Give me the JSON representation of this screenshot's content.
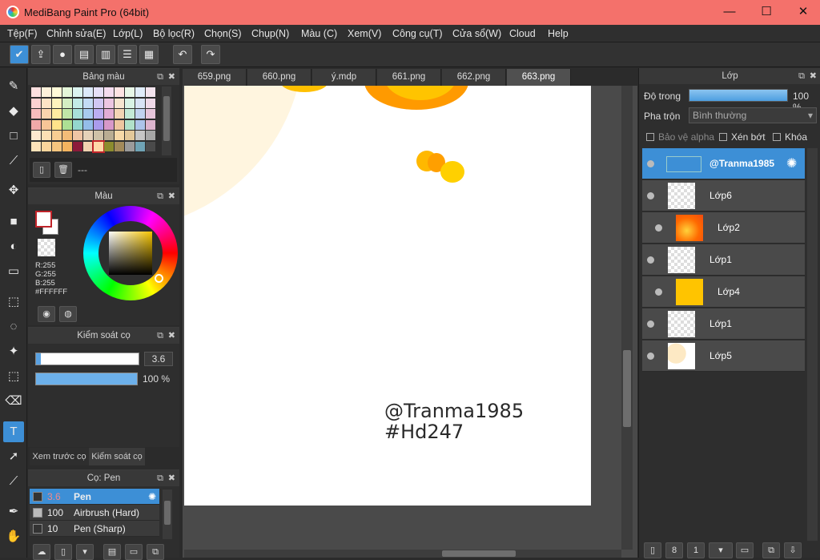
{
  "window": {
    "title": "MediBang Paint Pro (64bit)",
    "minimize": "—",
    "maximize": "☐",
    "close": "✕"
  },
  "menu": [
    "Tệp(F)",
    "Chỉnh sửa(E)",
    "Lớp(L)",
    "Bộ lọc(R)",
    "Chọn(S)",
    "Chụp(N)",
    "Màu (C)",
    "Xem(V)",
    "Công cụ(T)",
    "Cửa sổ(W)",
    "Cloud",
    "Help"
  ],
  "toolbar": {
    "undo": "↶",
    "redo": "↷"
  },
  "palette_panel": {
    "title": "Bảng màu",
    "set_label": "---"
  },
  "color_panel": {
    "title": "Màu",
    "r": "R:255",
    "g": "G:255",
    "b": "B:255",
    "hex": "#FFFFFF"
  },
  "brush_control": {
    "title": "Kiểm soát cọ",
    "size": "3.6",
    "opacity": "100 %",
    "opacity_value": 1.0
  },
  "bottom_tabs": [
    "Xem trước cọ",
    "Kiểm soát cọ"
  ],
  "brush_panel": {
    "title": "Cọ: Pen",
    "brushes": [
      {
        "size": "3.6",
        "name": "Pen",
        "color": "#333333"
      },
      {
        "size": "100",
        "name": "Airbrush (Hard)",
        "color": "#bbbbbb"
      },
      {
        "size": "10",
        "name": "Pen (Sharp)",
        "color": "#333333"
      }
    ]
  },
  "tabs": [
    "659.png",
    "660.png",
    "ý.mdp",
    "661.png",
    "662.png",
    "663.png"
  ],
  "canvas": {
    "text_line1": "@Tranma1985",
    "text_line2": "#Hd247"
  },
  "layers_panel": {
    "title": "Lớp",
    "opacity_label": "Độ trong",
    "opacity_value": "100 %",
    "blend_label": "Pha trộn",
    "blend_value": "Bình thường",
    "protect_alpha": "Bảo vệ alpha",
    "clip": "Xén bớt",
    "lock": "Khóa",
    "layers": [
      {
        "name": "@Tranma1985",
        "selected": true
      },
      {
        "name": "Lớp6"
      },
      {
        "name": "Lớp2",
        "clipped": true
      },
      {
        "name": "Lớp1"
      },
      {
        "name": "Lớp4",
        "clipped": true
      },
      {
        "name": "Lớp1"
      },
      {
        "name": "Lớp5"
      }
    ]
  },
  "colors": {
    "accent": "#3d8fd6",
    "titlebar": "#f4716b"
  }
}
